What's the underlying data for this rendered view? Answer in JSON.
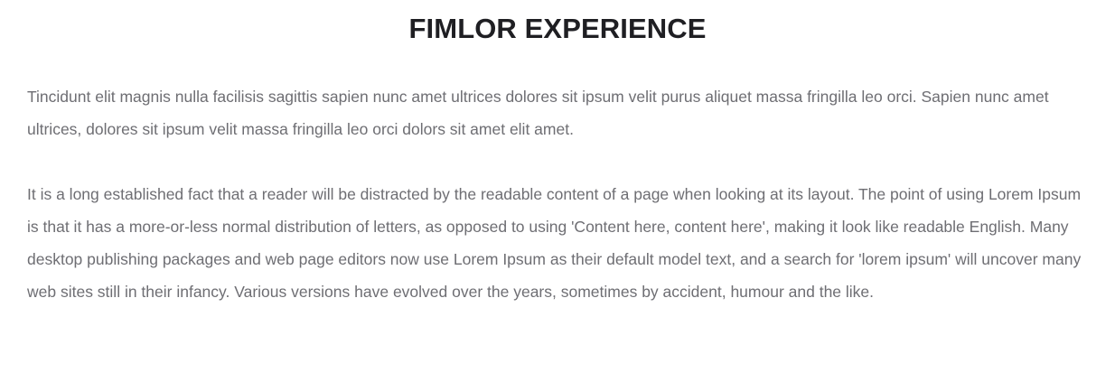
{
  "section": {
    "title": "FIMLOR EXPERIENCE",
    "paragraphs": [
      "Tincidunt elit magnis nulla facilisis sagittis sapien nunc amet ultrices dolores sit ipsum velit purus aliquet massa fringilla leo orci. Sapien nunc amet ultrices, dolores sit ipsum velit massa fringilla leo orci dolors sit amet elit amet.",
      "It is a long established fact that a reader will be distracted by the readable content of a page when looking at its layout. The point of using Lorem Ipsum is that it has a more-or-less normal distribution of letters, as opposed to using 'Content here, content here', making it look like readable English. Many desktop publishing packages and web page editors now use Lorem Ipsum as their default model text, and a search for 'lorem ipsum' will uncover many web sites still in their infancy. Various versions have evolved over the years, sometimes by accident, humour and the like."
    ]
  },
  "colors": {
    "title": "#1f1f23",
    "body_text": "#6e6e73",
    "background": "#ffffff"
  }
}
